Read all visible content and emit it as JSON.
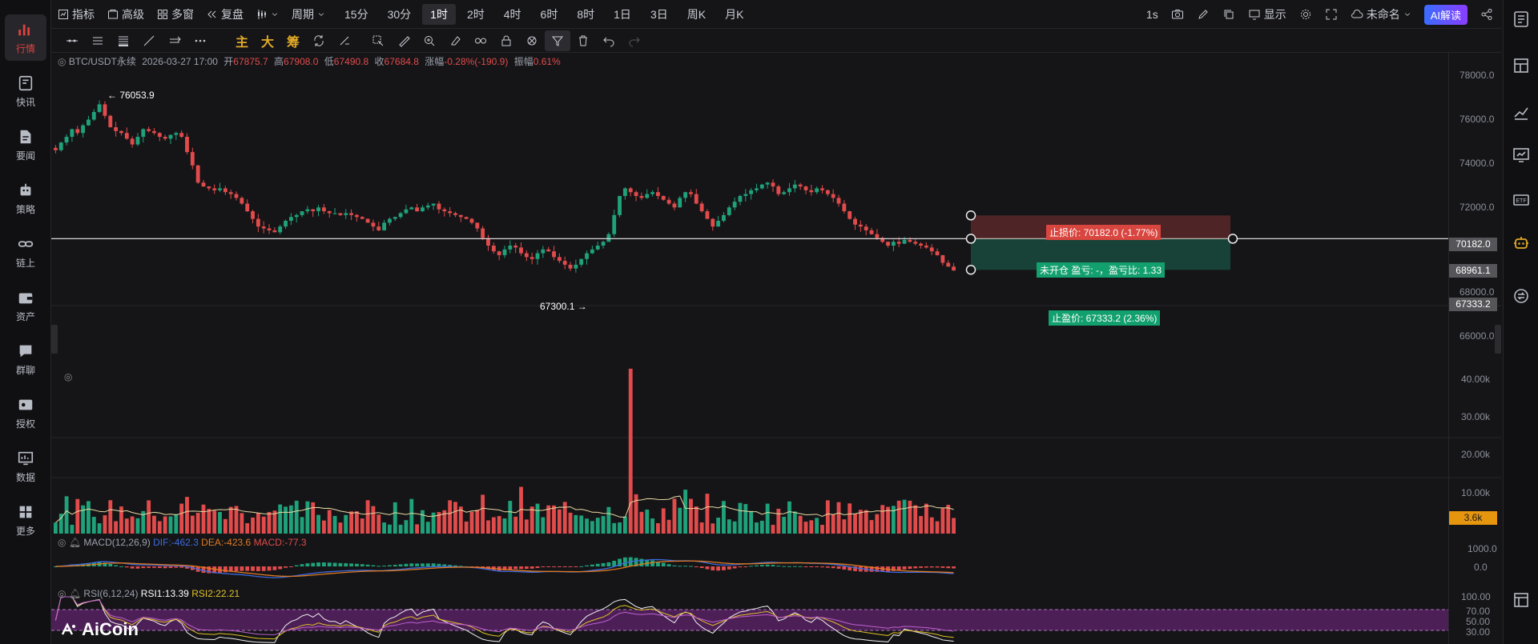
{
  "left_nav": [
    {
      "label": "行情",
      "icon": "bar-chart-icon",
      "active": true
    },
    {
      "label": "快讯",
      "icon": "news-flash-icon"
    },
    {
      "label": "要闻",
      "icon": "document-icon"
    },
    {
      "label": "策略",
      "icon": "robot-icon"
    },
    {
      "label": "链上",
      "icon": "chain-icon"
    },
    {
      "label": "资产",
      "icon": "wallet-icon"
    },
    {
      "label": "群聊",
      "icon": "chat-icon"
    },
    {
      "label": "授权",
      "icon": "key-icon"
    },
    {
      "label": "数据",
      "icon": "data-monitor-icon"
    },
    {
      "label": "更多",
      "icon": "grid-icon"
    }
  ],
  "topbar": {
    "indicators": "指标",
    "advanced": "高级",
    "multiwindow": "多窗",
    "replay": "复盘",
    "period": "周期",
    "intervals": [
      "15分",
      "30分",
      "1时",
      "2时",
      "4时",
      "6时",
      "8时",
      "1日",
      "3日",
      "周K",
      "月K"
    ],
    "active_interval": "1时",
    "refresh_rate": "1s",
    "display": "显示",
    "layout_name": "未命名",
    "ai_button": "AI解读"
  },
  "drawbar": {
    "main": "主",
    "big": "大",
    "chips": "筹"
  },
  "legend": {
    "symbol": "BTC/USDT永续",
    "time": "2026-03-27 17:00",
    "open_label": "开",
    "open": "67875.7",
    "high_label": "高",
    "high": "67908.0",
    "low_label": "低",
    "low": "67490.8",
    "close_label": "收",
    "close": "67684.8",
    "change_label": "涨幅",
    "change": "-0.28%(-190.9)",
    "amplitude_label": "振幅",
    "amplitude": "0.61%"
  },
  "annotations": {
    "high_marker": "← 76053.9",
    "low_marker": "67300.1 →",
    "stop_loss": "止损价: 70182.0 (-1.77%)",
    "position": "未开仓  盈亏: -，盈亏比: 1.33",
    "take_profit": "止盈价: 67333.2 (2.36%)"
  },
  "price_axis": {
    "ticks": [
      "78000.0",
      "76000.0",
      "74000.0",
      "72000.0",
      "68000.0",
      "66000.0"
    ],
    "tag_stop": "70182.0",
    "tag_entry": "68961.1",
    "tag_take": "67333.2"
  },
  "volume_axis": {
    "ticks": [
      "40.00k",
      "30.00k",
      "20.00k",
      "10.00k"
    ],
    "tag": "3.6k"
  },
  "macd": {
    "title": "MACD(12,26,9)",
    "dif": "DIF:-462.3",
    "dea": "DEA:-423.6",
    "macd": "MACD:-77.3",
    "ticks": [
      "1000.0",
      "0.0"
    ]
  },
  "rsi": {
    "title": "RSI(6,12,24)",
    "rsi1": "RSI1:13.39",
    "rsi2": "RSI2:22.21",
    "ticks": [
      "100.00",
      "70.00",
      "50.00",
      "30.00"
    ]
  },
  "logo": "AiCoin",
  "colors": {
    "up": "#1fa27a",
    "down": "#e14b4b",
    "bg": "#151518",
    "gold": "#e0a928"
  },
  "chart_data": {
    "type": "candlestick",
    "symbol": "BTC/USDT永续",
    "interval": "1时",
    "ylim": [
      65500,
      78700
    ],
    "extremes": {
      "high": 76053.9,
      "low": 67300.1
    },
    "close_path": [
      73600,
      74000,
      74300,
      74700,
      74500,
      74900,
      75200,
      75600,
      76000,
      75400,
      74800,
      74600,
      74500,
      74200,
      73900,
      74300,
      74700,
      74600,
      74500,
      74300,
      74200,
      74400,
      74500,
      74300,
      73500,
      72800,
      71900,
      71700,
      71600,
      71500,
      71600,
      71400,
      71300,
      71100,
      70800,
      70400,
      70000,
      69600,
      69500,
      69400,
      69300,
      69600,
      69900,
      70100,
      70200,
      70400,
      70500,
      70400,
      70600,
      70400,
      70300,
      70300,
      70200,
      70300,
      70200,
      70100,
      70000,
      69800,
      69600,
      69400,
      69800,
      70000,
      70100,
      70300,
      70500,
      70600,
      70400,
      70600,
      70700,
      70800,
      70500,
      70400,
      70300,
      70200,
      70100,
      70000,
      69800,
      69500,
      69000,
      68600,
      68300,
      68100,
      68400,
      68600,
      68500,
      68200,
      68000,
      67900,
      68200,
      68400,
      68300,
      68000,
      67800,
      67600,
      67400,
      67600,
      67900,
      68200,
      68400,
      68600,
      68800,
      69200,
      70200,
      71200,
      71600,
      71400,
      71200,
      71100,
      71300,
      71400,
      71200,
      71000,
      70800,
      70600,
      71100,
      71400,
      71300,
      70800,
      70400,
      70000,
      69600,
      69900,
      70200,
      70600,
      70900,
      71200,
      71300,
      71500,
      71600,
      71800,
      71900,
      71700,
      71300,
      71400,
      71600,
      71800,
      71700,
      71500,
      71400,
      71600,
      71500,
      71300,
      71100,
      70800,
      70400,
      70000,
      69700,
      69600,
      69400,
      69200,
      69000,
      68800,
      68600,
      68800,
      68700,
      68900,
      68800,
      68700,
      68600,
      68500,
      68300,
      68100,
      67700,
      67500,
      67300
    ],
    "volume_k": {
      "max_spike": 38,
      "last": 3.6
    },
    "trade_setup": {
      "entry": 68961.1,
      "stop_loss": 70182.0,
      "stop_loss_pct": "-1.77%",
      "take_profit": 67333.2,
      "take_profit_pct": "2.36%",
      "risk_reward": 1.33
    }
  }
}
